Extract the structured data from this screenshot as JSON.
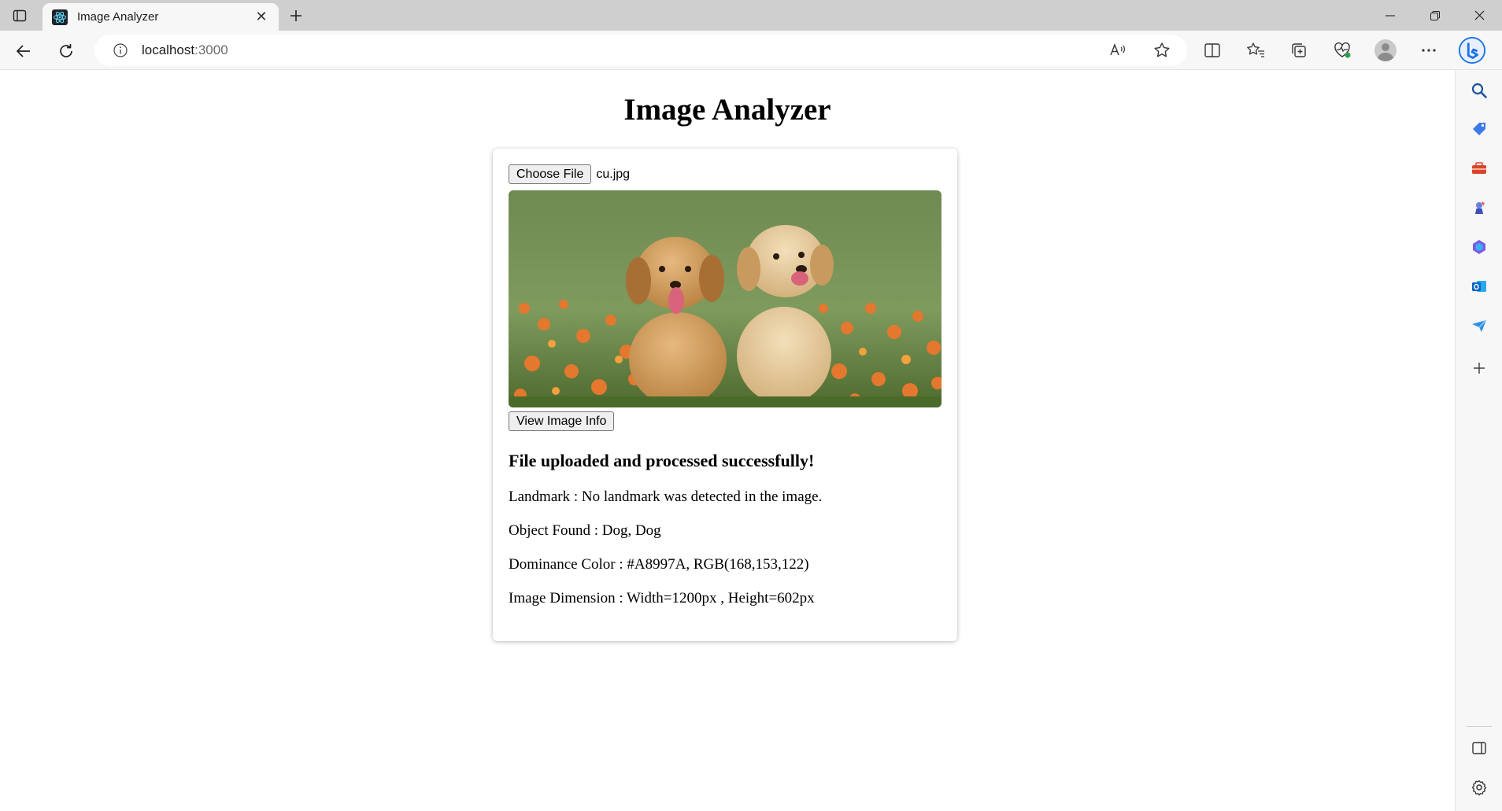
{
  "browser": {
    "tab_title": "Image Analyzer",
    "url_host": "localhost",
    "url_port": ":3000"
  },
  "page": {
    "title": "Image Analyzer",
    "choose_file_label": "Choose File",
    "file_name": "cu.jpg",
    "view_info_label": "View Image Info",
    "status_message": "File uploaded and processed successfully!",
    "info": [
      {
        "label": "Landmark",
        "value": "No landmark was detected in the image.",
        "text": "Landmark : No landmark was detected in the image."
      },
      {
        "label": "Object Found",
        "value": "Dog, Dog",
        "text": "Object Found : Dog, Dog"
      },
      {
        "label": "Dominance Color",
        "value": "#A8997A, RGB(168,153,122)",
        "text": "Dominance Color : #A8997A, RGB(168,153,122)"
      },
      {
        "label": "Image Dimension",
        "value": "Width=1200px , Height=602px",
        "text": "Image Dimension : Width=1200px , Height=602px"
      }
    ]
  },
  "colors": {
    "bing_blue": "#1a73e8",
    "tab_bar": "#cfcfcf",
    "toolbar": "#f7f7f7"
  }
}
